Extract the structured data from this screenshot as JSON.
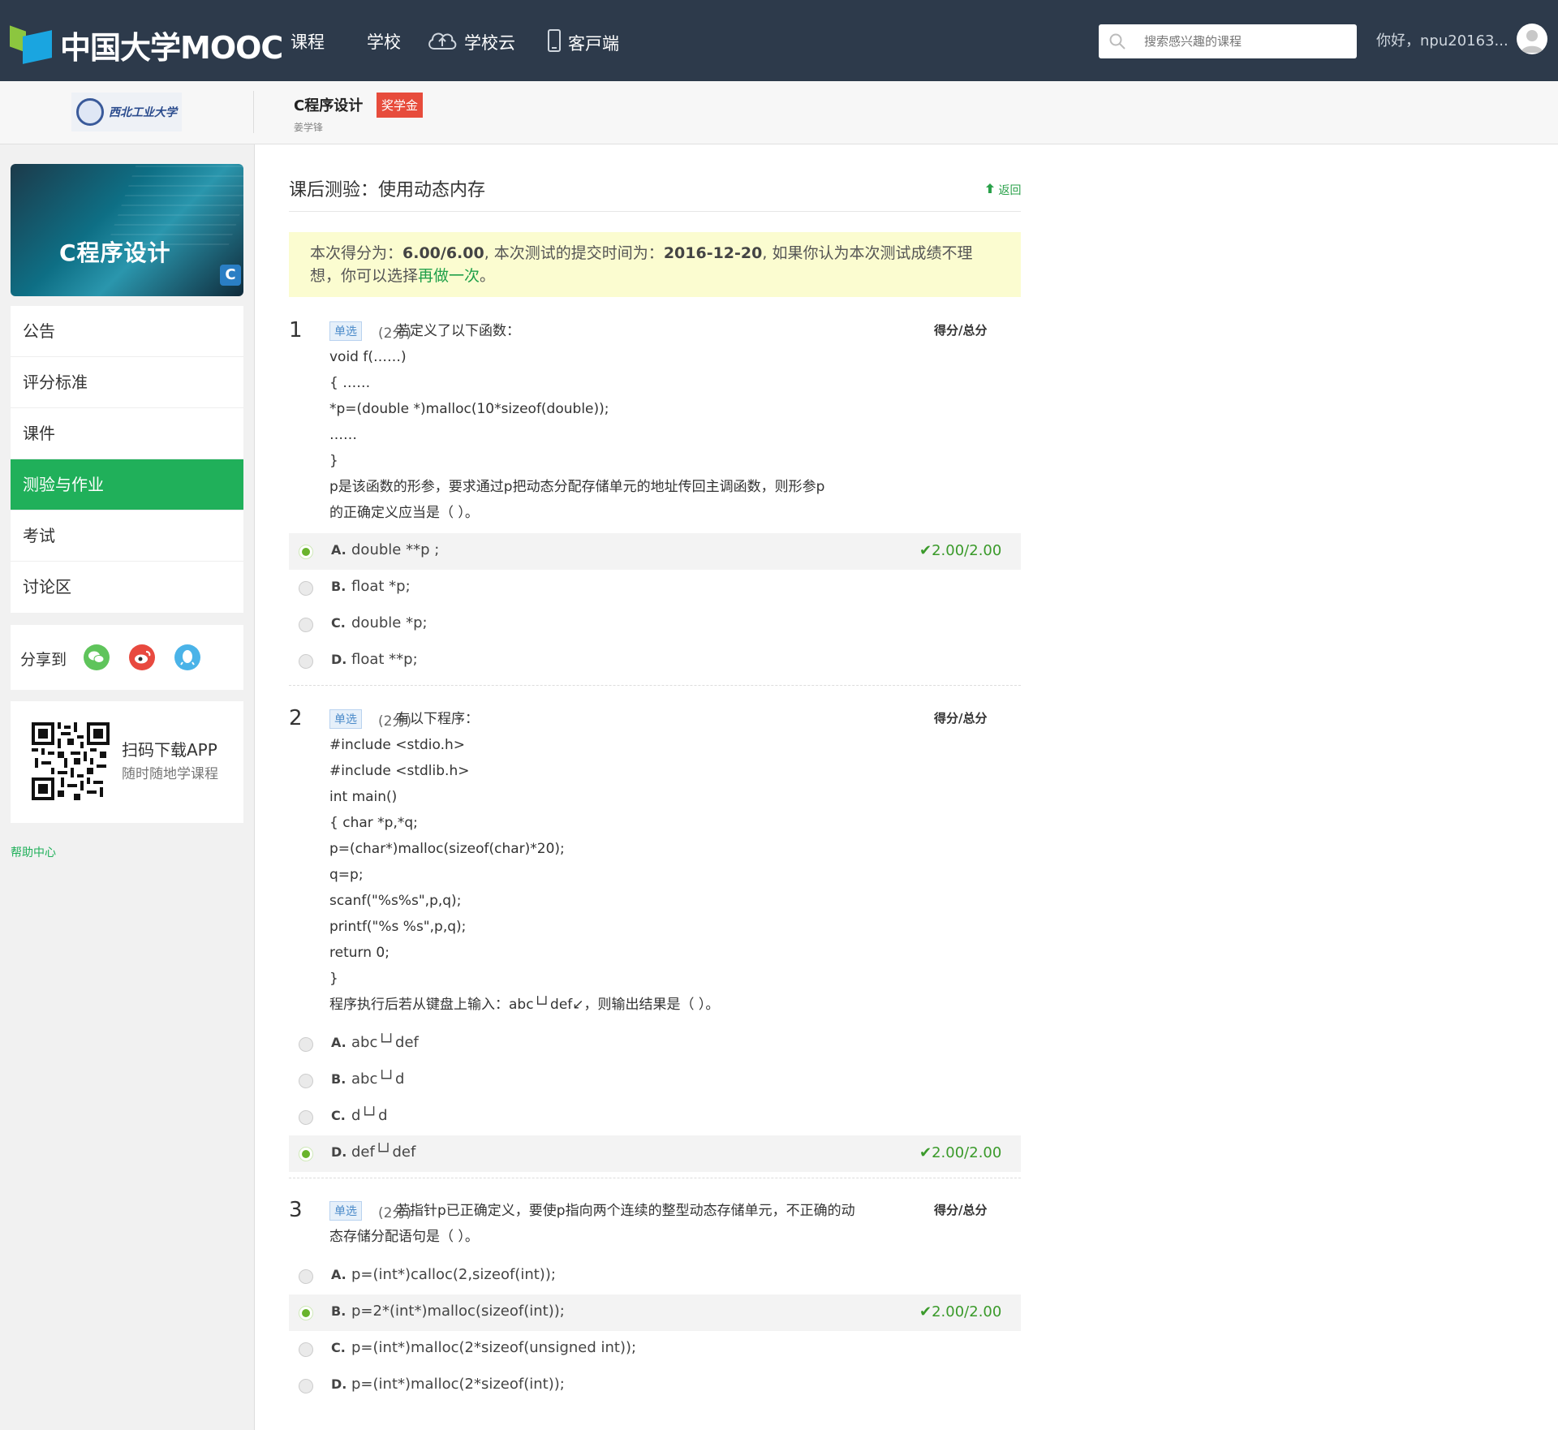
{
  "nav": {
    "brand": "中国大学MOOC",
    "items": [
      "课程",
      "学校",
      "学校云",
      "客戸端"
    ],
    "search_placeholder": "搜索感兴趣的课程",
    "greeting": "你好，npu20163..."
  },
  "course": {
    "school": "西北工业大学",
    "title": "C程序设计",
    "badge": "奖学金",
    "teacher": "姜学锋"
  },
  "sidebar": {
    "banner_title": "C程序设计",
    "banner_badge": "C",
    "menu": [
      "公告",
      "评分标准",
      "课件",
      "测验与作业",
      "考试",
      "讨论区"
    ],
    "active": "测验与作业",
    "share_label": "分享到",
    "share_icons": [
      "wechat-icon",
      "weibo-icon",
      "qq-icon"
    ],
    "app_title": "扫码下载APP",
    "app_sub": "随时随地学课程",
    "help": "帮助中心"
  },
  "main": {
    "title": "课后测验：使用动态内存",
    "back": "返回",
    "notice": {
      "p1": "本次得分为：",
      "score": "6.00/6.00",
      "p2": ", 本次测试的提交时间为：",
      "time": "2016-12-20",
      "p3": ", 如果你认为本次测试成绩不理想，你可以选择",
      "redo": "再做一次",
      "p4": "。"
    },
    "score_header": "得分/总分",
    "questions": [
      {
        "num": "1",
        "type": "单选",
        "points": "(2分)",
        "lines": [
          "若定义了以下函数：",
          " void f(……)",
          "{ ……",
          " *p=(double *)malloc(10*sizeof(double));",
          " ……",
          "}",
          "p是该函数的形参，要求通过p把动态分配存储单元的地址传回主调函数，则形参p",
          "的正确定义应当是（ ）。"
        ],
        "options": [
          {
            "letter": "A.",
            "text": "double **p ;",
            "selected": true,
            "score": "2.00/2.00"
          },
          {
            "letter": "B.",
            "text": "float *p;",
            "selected": false,
            "score": ""
          },
          {
            "letter": "C.",
            "text": "double *p;",
            "selected": false,
            "score": ""
          },
          {
            "letter": "D.",
            "text": "float **p;",
            "selected": false,
            "score": ""
          }
        ]
      },
      {
        "num": "2",
        "type": "单选",
        "points": "(2分)",
        "lines": [
          "有以下程序：",
          " #include <stdio.h>",
          "#include <stdlib.h>",
          "int main()",
          "{ char *p,*q;",
          "p=(char*)malloc(sizeof(char)*20);",
          "q=p;",
          "scanf(\"%s%s\",p,q);",
          "printf(\"%s %s\",p,q);",
          "return 0;",
          "}",
          "程序执行后若从键盘上输入：abc└┘def↙，则输出结果是（ ）。"
        ],
        "options": [
          {
            "letter": "A.",
            "text": "abc└┘def",
            "selected": false,
            "score": ""
          },
          {
            "letter": "B.",
            "text": "abc└┘d",
            "selected": false,
            "score": ""
          },
          {
            "letter": "C.",
            "text": "d└┘d",
            "selected": false,
            "score": ""
          },
          {
            "letter": "D.",
            "text": "def└┘def",
            "selected": true,
            "score": "2.00/2.00"
          }
        ]
      },
      {
        "num": "3",
        "type": "单选",
        "points": "(2分)",
        "lines": [
          "若指针p已正确定义，要使p指向两个连续的整型动态存储单元，不正确的动",
          "态存储分配语句是（ ）。"
        ],
        "options": [
          {
            "letter": "A.",
            "text": "p=(int*)calloc(2,sizeof(int));",
            "selected": false,
            "score": ""
          },
          {
            "letter": "B.",
            "text": "p=2*(int*)malloc(sizeof(int));",
            "selected": true,
            "score": "2.00/2.00"
          },
          {
            "letter": "C.",
            "text": "p=(int*)malloc(2*sizeof(unsigned int));",
            "selected": false,
            "score": ""
          },
          {
            "letter": "D.",
            "text": " p=(int*)malloc(2*sizeof(int));",
            "selected": false,
            "score": ""
          }
        ]
      }
    ]
  }
}
